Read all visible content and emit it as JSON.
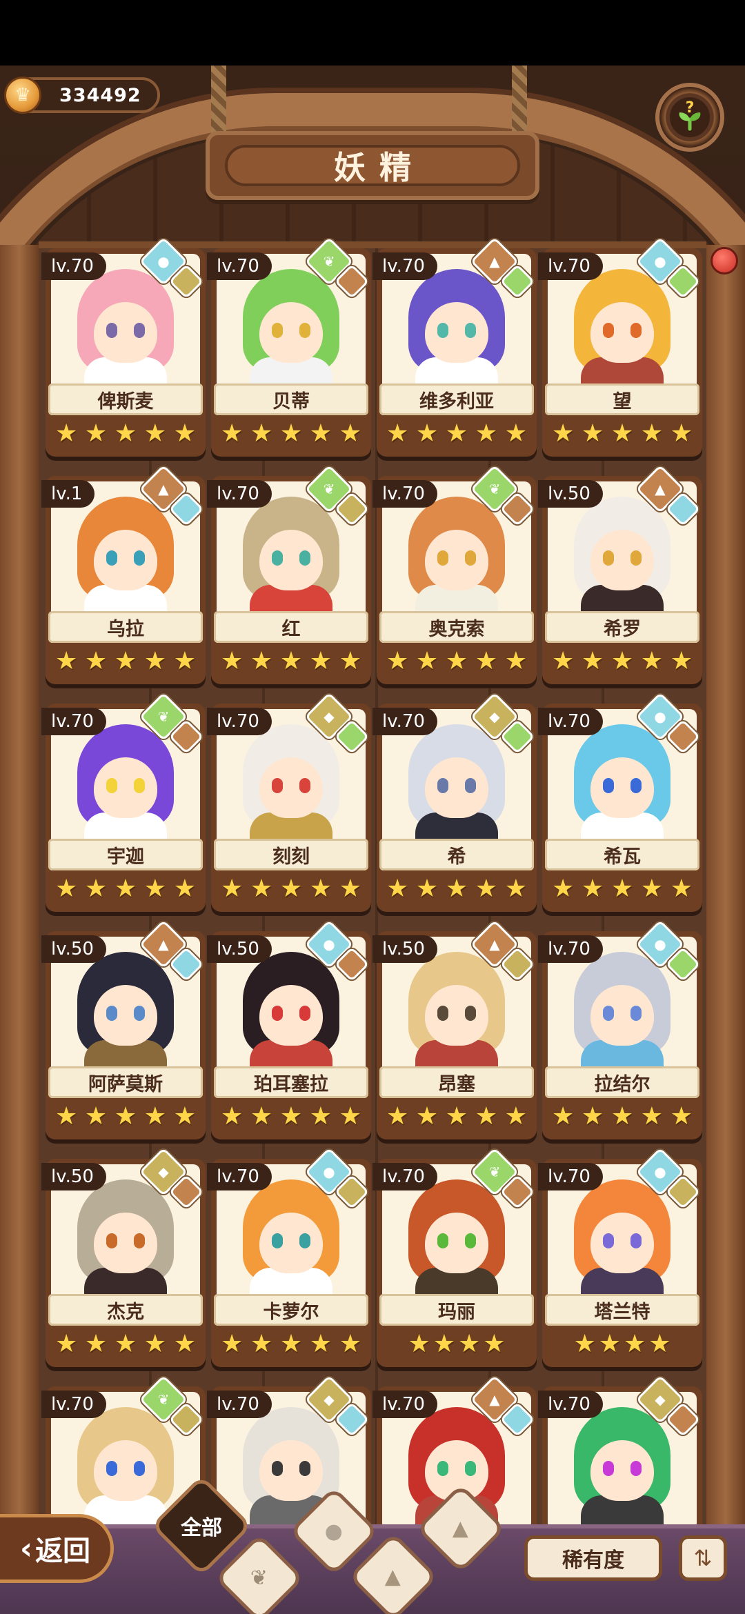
{
  "header": {
    "currency_value": "334492",
    "title": "妖精"
  },
  "heroes": [
    {
      "level": "lv.70",
      "name": "俾斯麦",
      "stars": 5,
      "element": "water",
      "sub": "sand",
      "hair": "#f6a8b8",
      "eyes": "#7b6aa8",
      "body": "#ffffff"
    },
    {
      "level": "lv.70",
      "name": "贝蒂",
      "stars": 5,
      "element": "leaf",
      "sub": "earth",
      "hair": "#7fcf5a",
      "eyes": "#e0b23a",
      "body": "#f3f3f3"
    },
    {
      "level": "lv.70",
      "name": "维多利亚",
      "stars": 5,
      "element": "earth",
      "sub": "leaf",
      "hair": "#6a56c8",
      "eyes": "#53b8a8",
      "body": "#ffffff"
    },
    {
      "level": "lv.70",
      "name": "望",
      "stars": 5,
      "element": "water",
      "sub": "leaf",
      "hair": "#f3b53a",
      "eyes": "#e06a2a",
      "body": "#b0483a"
    },
    {
      "level": "lv.1",
      "name": "乌拉",
      "stars": 5,
      "element": "earth",
      "sub": "water",
      "hair": "#e8863a",
      "eyes": "#3aa0b8",
      "body": "#ffffff"
    },
    {
      "level": "lv.70",
      "name": "红",
      "stars": 5,
      "element": "leaf",
      "sub": "sand",
      "hair": "#c9b48a",
      "eyes": "#4ab0a0",
      "body": "#d8443a"
    },
    {
      "level": "lv.70",
      "name": "奥克索",
      "stars": 5,
      "element": "leaf",
      "sub": "earth",
      "hair": "#e08a4a",
      "eyes": "#e0a83a",
      "body": "#f3efe0"
    },
    {
      "level": "lv.50",
      "name": "希罗",
      "stars": 5,
      "element": "earth",
      "sub": "water",
      "hair": "#f1ede6",
      "eyes": "#e0a83a",
      "body": "#3a2a2a"
    },
    {
      "level": "lv.70",
      "name": "宇迦",
      "stars": 5,
      "element": "leaf",
      "sub": "earth",
      "hair": "#7a48d8",
      "eyes": "#f3d23a",
      "body": "#ffffff"
    },
    {
      "level": "lv.70",
      "name": "刻刻",
      "stars": 5,
      "element": "sand",
      "sub": "leaf",
      "hair": "#f1ede6",
      "eyes": "#d8443a",
      "body": "#c9a34a"
    },
    {
      "level": "lv.70",
      "name": "希",
      "stars": 5,
      "element": "sand",
      "sub": "leaf",
      "hair": "#d8dce6",
      "eyes": "#6a7aa8",
      "body": "#2e2e3a"
    },
    {
      "level": "lv.70",
      "name": "希瓦",
      "stars": 5,
      "element": "water",
      "sub": "earth",
      "hair": "#6ac8e8",
      "eyes": "#3a6ad8",
      "body": "#ffffff"
    },
    {
      "level": "lv.50",
      "name": "阿萨莫斯",
      "stars": 5,
      "element": "earth",
      "sub": "water",
      "hair": "#2a2a3a",
      "eyes": "#5a8ac8",
      "body": "#8a6a3a"
    },
    {
      "level": "lv.50",
      "name": "珀耳塞拉",
      "stars": 5,
      "element": "water",
      "sub": "earth",
      "hair": "#2a1e22",
      "eyes": "#d83a3a",
      "body": "#c8443a"
    },
    {
      "level": "lv.50",
      "name": "昂塞",
      "stars": 5,
      "element": "earth",
      "sub": "sand",
      "hair": "#e8c88a",
      "eyes": "#5a4a3a",
      "body": "#b8443a"
    },
    {
      "level": "lv.70",
      "name": "拉结尔",
      "stars": 5,
      "element": "water",
      "sub": "leaf",
      "hair": "#c8ccd8",
      "eyes": "#6a8ad8",
      "body": "#6ab8e0"
    },
    {
      "level": "lv.50",
      "name": "杰克",
      "stars": 5,
      "element": "sand",
      "sub": "earth",
      "hair": "#b8ad96",
      "eyes": "#c86a2a",
      "body": "#3a2a2a"
    },
    {
      "level": "lv.70",
      "name": "卡萝尔",
      "stars": 5,
      "element": "water",
      "sub": "sand",
      "hair": "#f39a3a",
      "eyes": "#3aa0a0",
      "body": "#ffffff"
    },
    {
      "level": "lv.70",
      "name": "玛丽",
      "stars": 4,
      "element": "leaf",
      "sub": "earth",
      "hair": "#c8582a",
      "eyes": "#5ab83a",
      "body": "#4a3a2a"
    },
    {
      "level": "lv.70",
      "name": "塔兰特",
      "stars": 4,
      "element": "water",
      "sub": "sand",
      "hair": "#f3863a",
      "eyes": "#7a6ad8",
      "body": "#4a3a5a"
    },
    {
      "level": "lv.70",
      "name": "",
      "stars": 0,
      "element": "leaf",
      "sub": "sand",
      "hair": "#e8c88a",
      "eyes": "#3a6ad8",
      "body": "#ffffff"
    },
    {
      "level": "lv.70",
      "name": "",
      "stars": 0,
      "element": "sand",
      "sub": "water",
      "hair": "#e6e2da",
      "eyes": "#3a3a3a",
      "body": "#6a6a6a"
    },
    {
      "level": "lv.70",
      "name": "",
      "stars": 0,
      "element": "earth",
      "sub": "water",
      "hair": "#c8302a",
      "eyes": "#3ab87a",
      "body": "#b8443a"
    },
    {
      "level": "lv.70",
      "name": "",
      "stars": 0,
      "element": "sand",
      "sub": "earth",
      "hair": "#3ab86a",
      "eyes": "#c83ad8",
      "body": "#3a3a3a"
    }
  ],
  "footer": {
    "back_label": "返回",
    "filter_all_label": "全部",
    "rarity_label": "稀有度"
  }
}
